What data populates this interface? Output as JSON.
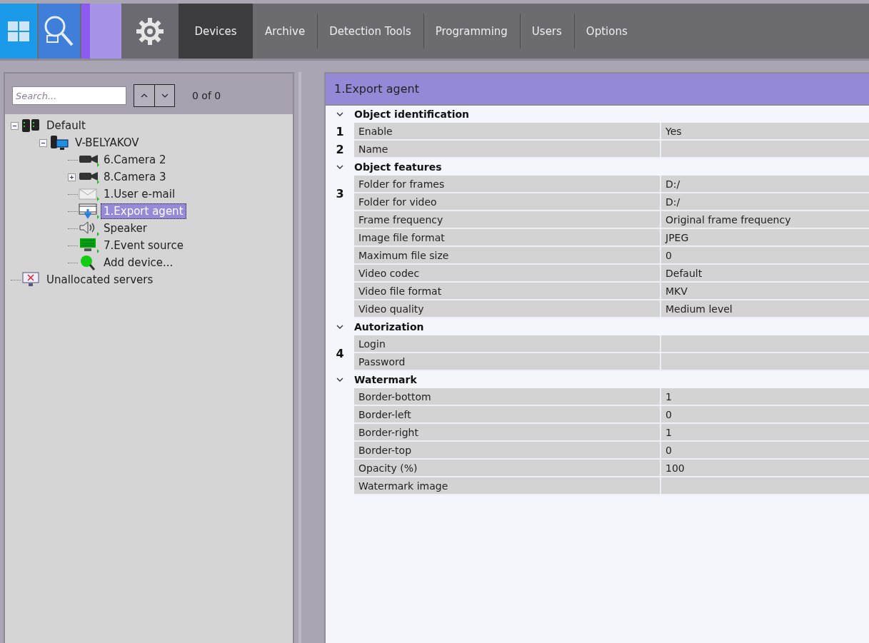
{
  "toolbar": {
    "tabs": [
      {
        "label": "Devices",
        "selected": true
      },
      {
        "label": "Archive",
        "selected": false
      },
      {
        "label": "Detection Tools",
        "selected": false
      },
      {
        "label": "Programming",
        "selected": false
      },
      {
        "label": "Users",
        "selected": false
      },
      {
        "label": "Options",
        "selected": false
      }
    ]
  },
  "search": {
    "placeholder": "Search...",
    "count": "0 of 0"
  },
  "tree": [
    {
      "label": "Default",
      "kind": "server-group",
      "expanded": true,
      "selected": false,
      "children": [
        {
          "label": "V-BELYAKOV",
          "kind": "computer",
          "expanded": true,
          "selected": false,
          "children": [
            {
              "label": "6.Camera 2",
              "kind": "camera",
              "selected": false
            },
            {
              "label": "8.Camera 3",
              "kind": "camera",
              "expanded": false,
              "selected": false
            },
            {
              "label": "1.User e-mail",
              "kind": "mail",
              "selected": false
            },
            {
              "label": "1.Export agent",
              "kind": "export",
              "selected": true
            },
            {
              "label": "Speaker",
              "kind": "speaker",
              "selected": false
            },
            {
              "label": "7.Event source",
              "kind": "event",
              "selected": false
            },
            {
              "label": "Add device...",
              "kind": "add",
              "selected": false
            }
          ]
        }
      ]
    },
    {
      "label": "Unallocated servers",
      "kind": "unallocated",
      "selected": false
    }
  ],
  "panel": {
    "title": "1.Export agent",
    "groups": [
      {
        "title": "Object identification",
        "expanded": true,
        "blocks": [
          {
            "marker": "1",
            "rows": [
              {
                "label": "Enable",
                "value": "Yes"
              }
            ]
          },
          {
            "marker": "2",
            "rows": [
              {
                "label": "Name"
              }
            ]
          }
        ]
      },
      {
        "title": "Object features",
        "expanded": true,
        "blocks": [
          {
            "marker": "3",
            "rows": [
              {
                "label": "Folder for frames",
                "value": "D:/"
              },
              {
                "label": "Folder for video",
                "value": "D:/"
              }
            ]
          },
          {
            "rows": [
              {
                "label": "Frame frequency",
                "value": "Original frame frequency"
              },
              {
                "label": "Image file format",
                "value": "JPEG"
              },
              {
                "label": "Maximum file size",
                "value": "0"
              },
              {
                "label": "Video codec",
                "value": "Default"
              },
              {
                "label": "Video file format",
                "value": "MKV"
              },
              {
                "label": "Video quality",
                "value": "Medium level"
              }
            ]
          }
        ]
      },
      {
        "title": "Autorization",
        "expanded": true,
        "blocks": [
          {
            "marker": "4",
            "rows": [
              {
                "label": "Login"
              },
              {
                "label": "Password"
              }
            ]
          }
        ]
      },
      {
        "title": "Watermark",
        "expanded": true,
        "blocks": [
          {
            "rows": [
              {
                "label": "Border-bottom",
                "value": "1"
              },
              {
                "label": "Border-left",
                "value": "0"
              },
              {
                "label": "Border-right",
                "value": "1"
              },
              {
                "label": "Border-top",
                "value": "0"
              },
              {
                "label": "Opacity (%)",
                "value": "100"
              },
              {
                "label": "Watermark image"
              }
            ]
          }
        ]
      }
    ]
  }
}
